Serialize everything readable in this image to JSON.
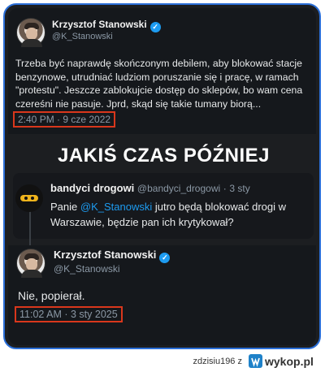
{
  "tweet_original": {
    "author_name": "Krzysztof Stanowski",
    "author_handle": "@K_Stanowski",
    "verified_icon": "verified-badge-icon",
    "text_lines": [
      "Trzeba być naprawdę skończonym debilem, aby blokować stacje",
      "benzynowe, utrudniać ludziom poruszanie się i pracę, w ramach",
      "\"protestu\". Jeszcze zablokujcie dostęp do sklepów, bo wam cena",
      "czereśni nie pasuje. Jprd, skąd się takie tumany biorą..."
    ],
    "timestamp": "2:40 PM · 9 cze 2022"
  },
  "headline": "JAKIŚ CZAS PÓŹNIEJ",
  "reply_quoted": {
    "author_name": "bandyci drogowi",
    "author_handle": "@bandyci_drogowi",
    "separator": "·",
    "age": "3 sty",
    "text_prefix": "Panie ",
    "mention": "@K_Stanowski",
    "text_suffix_line1": " jutro będą blokować drogi w",
    "text_line2": "Warszawie, będzie pan ich krytykował?"
  },
  "tweet_reply": {
    "author_name": "Krzysztof Stanowski",
    "author_handle": "@K_Stanowski",
    "text": "Nie, popierał.",
    "timestamp": "11:02 AM · 3 sty 2025"
  },
  "footer": {
    "username": "zdzisiu196",
    "connector": "z",
    "logo_text": "wykop.pl"
  },
  "colors": {
    "frame_border": "#2b6fd8",
    "stamp_border": "#d9371c",
    "mention": "#1d9bf0",
    "logo_bg": "#1f82c9"
  }
}
